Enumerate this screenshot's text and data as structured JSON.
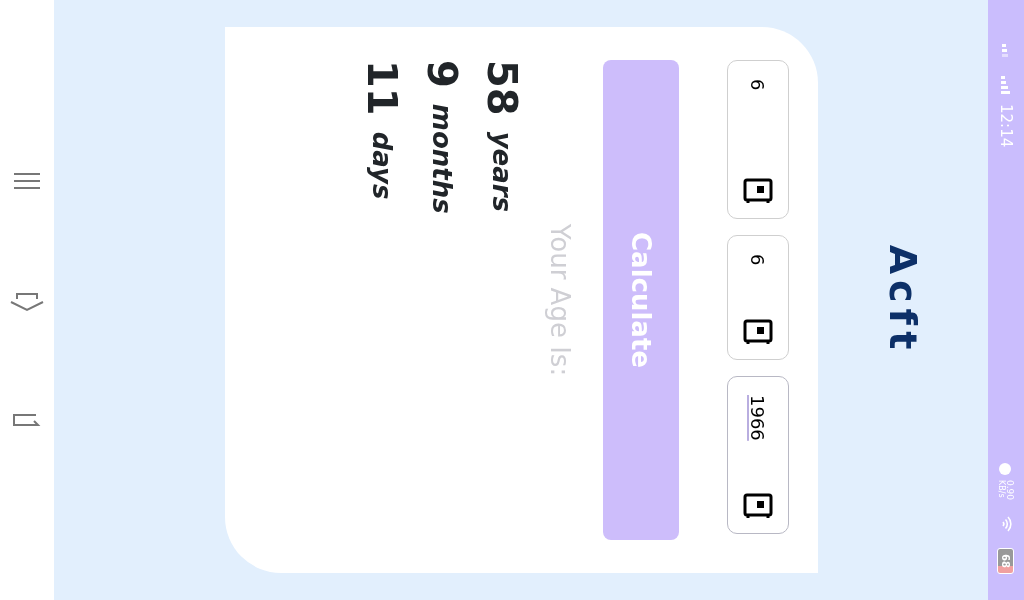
{
  "status_bar": {
    "time": "12:14",
    "net_speed": "0.90",
    "net_unit": "KB/s",
    "battery": "68"
  },
  "title": "Acft",
  "fields": [
    {
      "value": "6",
      "focused": false
    },
    {
      "value": "6",
      "focused": false
    },
    {
      "value": "1966",
      "focused": true
    }
  ],
  "button": "Calculate",
  "result_label": "Your Age Is:",
  "results": [
    {
      "value": "58",
      "unit": "years"
    },
    {
      "value": "9",
      "unit": "months"
    },
    {
      "value": "11",
      "unit": "days"
    }
  ]
}
